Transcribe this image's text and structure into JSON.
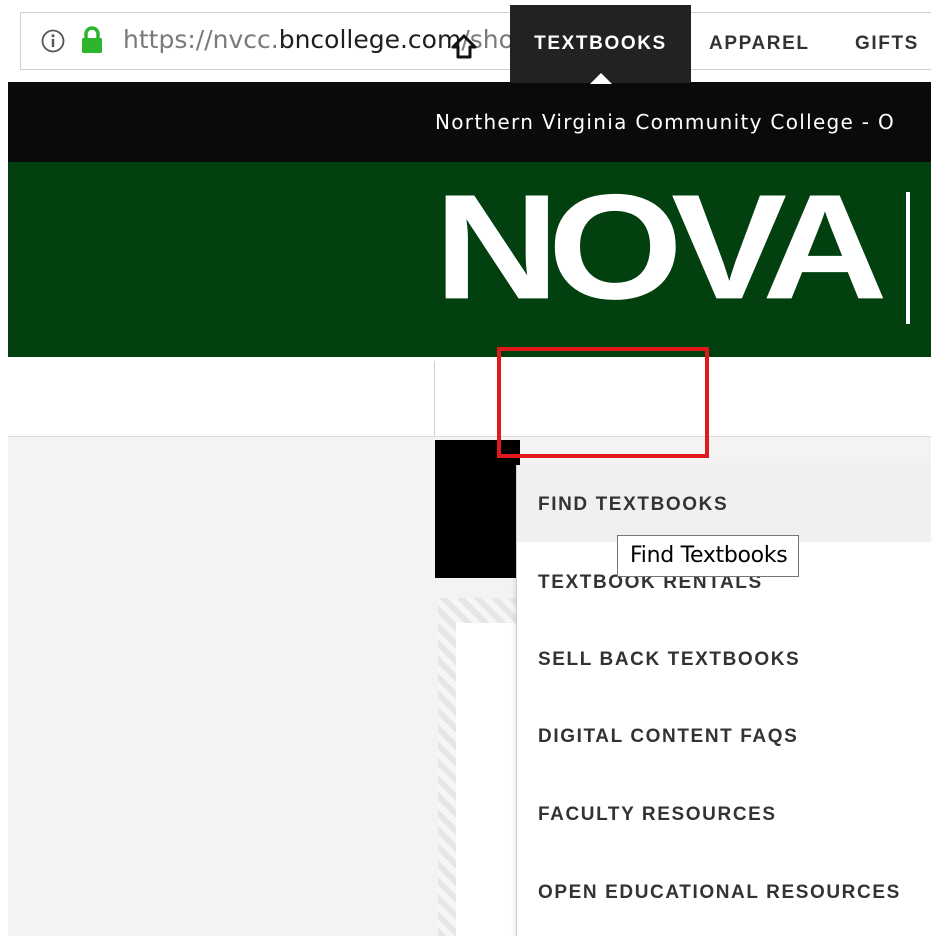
{
  "browser": {
    "url_prefix": "https://nvcc.",
    "url_domain": "bncollege.com",
    "url_path": "/shop/nv-cc/home"
  },
  "topbar": {
    "text": "Northern Virginia Community College - O"
  },
  "brand": {
    "logo_text": "NOVA"
  },
  "nav": {
    "active_label": "TEXTBOOKS",
    "items": [
      "APPAREL",
      "GIFTS"
    ]
  },
  "dropdown": {
    "items": [
      "FIND TEXTBOOKS",
      "TEXTBOOK RENTALS",
      "SELL BACK TEXTBOOKS",
      "DIGITAL CONTENT FAQS",
      "FACULTY RESOURCES",
      "OPEN EDUCATIONAL RESOURCES"
    ]
  },
  "tooltip": {
    "text": "Find Textbooks"
  },
  "colors": {
    "brand_green": "#03400f",
    "highlight_red": "#e0191d",
    "lock_green": "#2db52d"
  }
}
